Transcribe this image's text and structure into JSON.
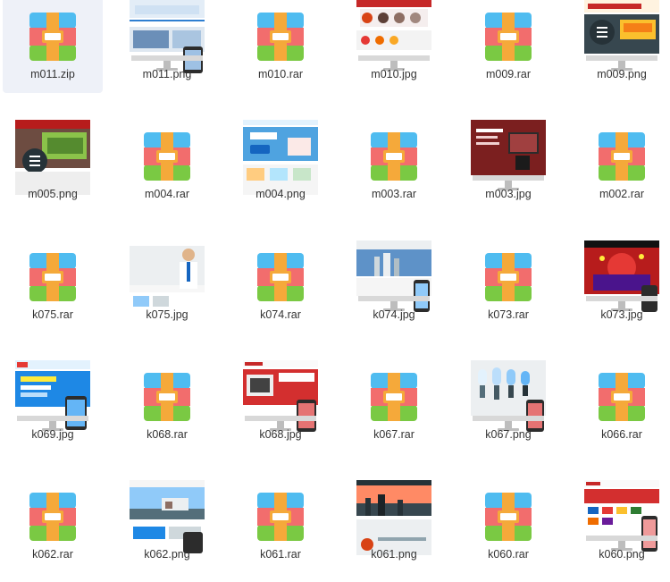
{
  "rows": [
    {
      "items": [
        {
          "name": "m011.zip",
          "kind": "archive",
          "selected": true
        },
        {
          "name": "m011.png",
          "kind": "image",
          "theme": "light-blue"
        },
        {
          "name": "m010.rar",
          "kind": "archive"
        },
        {
          "name": "m010.jpg",
          "kind": "image",
          "theme": "red-shop"
        },
        {
          "name": "m009.rar",
          "kind": "archive"
        },
        {
          "name": "m009.png",
          "kind": "image",
          "theme": "yellow-machine"
        }
      ]
    },
    {
      "items": [
        {
          "name": "m005.png",
          "kind": "image",
          "theme": "red-farm"
        },
        {
          "name": "m004.rar",
          "kind": "archive"
        },
        {
          "name": "m004.png",
          "kind": "image",
          "theme": "blue-banner"
        },
        {
          "name": "m003.rar",
          "kind": "archive"
        },
        {
          "name": "m003.jpg",
          "kind": "image",
          "theme": "dark-red-brand"
        },
        {
          "name": "m002.rar",
          "kind": "archive"
        }
      ]
    },
    {
      "items": [
        {
          "name": "k075.rar",
          "kind": "archive"
        },
        {
          "name": "k075.jpg",
          "kind": "image",
          "theme": "white-person"
        },
        {
          "name": "k074.rar",
          "kind": "archive"
        },
        {
          "name": "k074.jpg",
          "kind": "image",
          "theme": "city-monitor"
        },
        {
          "name": "k073.rar",
          "kind": "archive"
        },
        {
          "name": "k073.jpg",
          "kind": "image",
          "theme": "red-stage"
        }
      ]
    },
    {
      "items": [
        {
          "name": "k069.jpg",
          "kind": "image",
          "theme": "blue-monitor"
        },
        {
          "name": "k068.rar",
          "kind": "archive"
        },
        {
          "name": "k068.jpg",
          "kind": "image",
          "theme": "red-devices"
        },
        {
          "name": "k067.rar",
          "kind": "archive"
        },
        {
          "name": "k067.png",
          "kind": "image",
          "theme": "bulbs-monitor"
        },
        {
          "name": "k066.rar",
          "kind": "archive"
        }
      ]
    },
    {
      "items": [
        {
          "name": "k062.rar",
          "kind": "archive"
        },
        {
          "name": "k062.png",
          "kind": "image",
          "theme": "house-sky"
        },
        {
          "name": "k061.rar",
          "kind": "archive"
        },
        {
          "name": "k061.png",
          "kind": "image",
          "theme": "dusk-city"
        },
        {
          "name": "k060.rar",
          "kind": "archive"
        },
        {
          "name": "k060.png",
          "kind": "image",
          "theme": "red-logos-monitor"
        }
      ]
    }
  ],
  "icon_colors": {
    "top": "#4fbcf0",
    "middle": "#f26d6d",
    "bottom": "#7ac943",
    "strap": "#f5a93a",
    "buckle": "#ffffff"
  },
  "selection_color": "#eef1f8",
  "label_color": "#333333"
}
